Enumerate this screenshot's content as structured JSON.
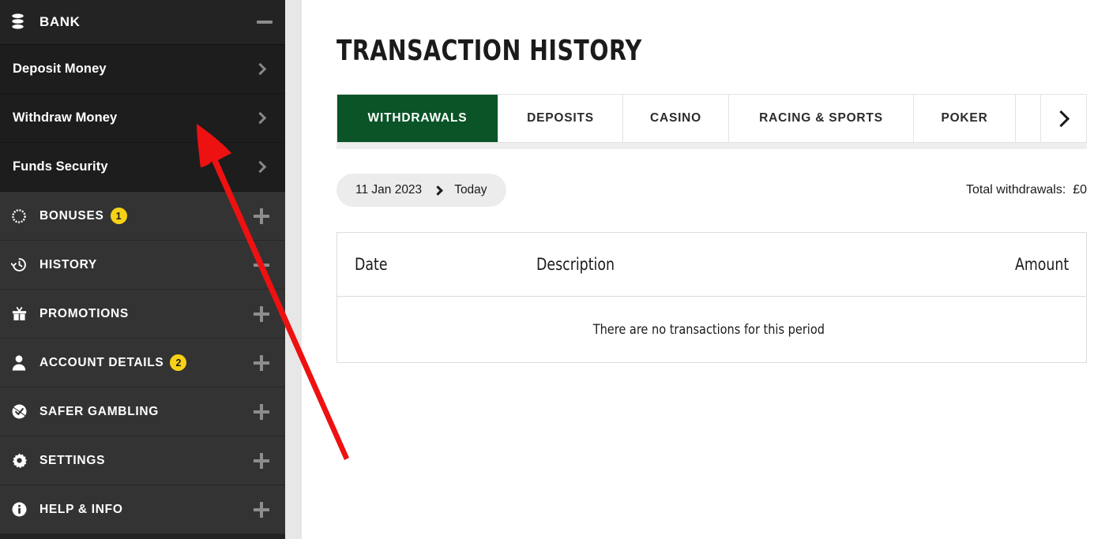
{
  "sidebar": {
    "header": {
      "title": "BANK",
      "icon": "database-icon",
      "toggle": "minus-icon"
    },
    "sub_items": [
      {
        "label": "Deposit Money",
        "chevron": "chevron-right-icon"
      },
      {
        "label": "Withdraw Money",
        "chevron": "chevron-right-icon"
      },
      {
        "label": "Funds Security",
        "chevron": "chevron-right-icon"
      }
    ],
    "main_items": [
      {
        "label": "BONUSES",
        "icon": "coin-icon",
        "badge": "1",
        "toggle": "plus-icon"
      },
      {
        "label": "HISTORY",
        "icon": "clock-history-icon",
        "badge": "",
        "toggle": "minus-icon"
      },
      {
        "label": "PROMOTIONS",
        "icon": "gift-icon",
        "badge": "",
        "toggle": "plus-icon"
      },
      {
        "label": "ACCOUNT DETAILS",
        "icon": "person-icon",
        "badge": "2",
        "toggle": "plus-icon"
      },
      {
        "label": "SAFER GAMBLING",
        "icon": "shield-check-icon",
        "badge": "",
        "toggle": "plus-icon"
      },
      {
        "label": "SETTINGS",
        "icon": "gear-icon",
        "badge": "",
        "toggle": "plus-icon"
      },
      {
        "label": "HELP & INFO",
        "icon": "info-icon",
        "badge": "",
        "toggle": "plus-icon"
      }
    ]
  },
  "main": {
    "page_title": "TRANSACTION HISTORY",
    "tabs": [
      {
        "label": "WITHDRAWALS",
        "active": true
      },
      {
        "label": "DEPOSITS",
        "active": false
      },
      {
        "label": "CASINO",
        "active": false
      },
      {
        "label": "RACING & SPORTS",
        "active": false
      },
      {
        "label": "POKER",
        "active": false
      }
    ],
    "tabs_next_icon": "chevron-right-icon",
    "filter": {
      "date_from": "11 Jan 2023",
      "date_separator": "chevron-right-icon",
      "date_to": "Today"
    },
    "total_label": "Total withdrawals:  £0",
    "table": {
      "columns": [
        "Date",
        "Description",
        "Amount"
      ],
      "rows": [],
      "empty_message": "There are no transactions for this period"
    }
  },
  "annotation": {
    "type": "arrow",
    "color": "#ee1111",
    "points_to": "Withdraw Money"
  },
  "colors": {
    "sidebar_bg": "#232323",
    "sidebar_sub_bg": "#1d1d1d",
    "sidebar_main_bg": "#333333",
    "accent_green": "#0a5427",
    "badge_yellow": "#f7d117",
    "gap_gray": "#e7e7e7"
  }
}
